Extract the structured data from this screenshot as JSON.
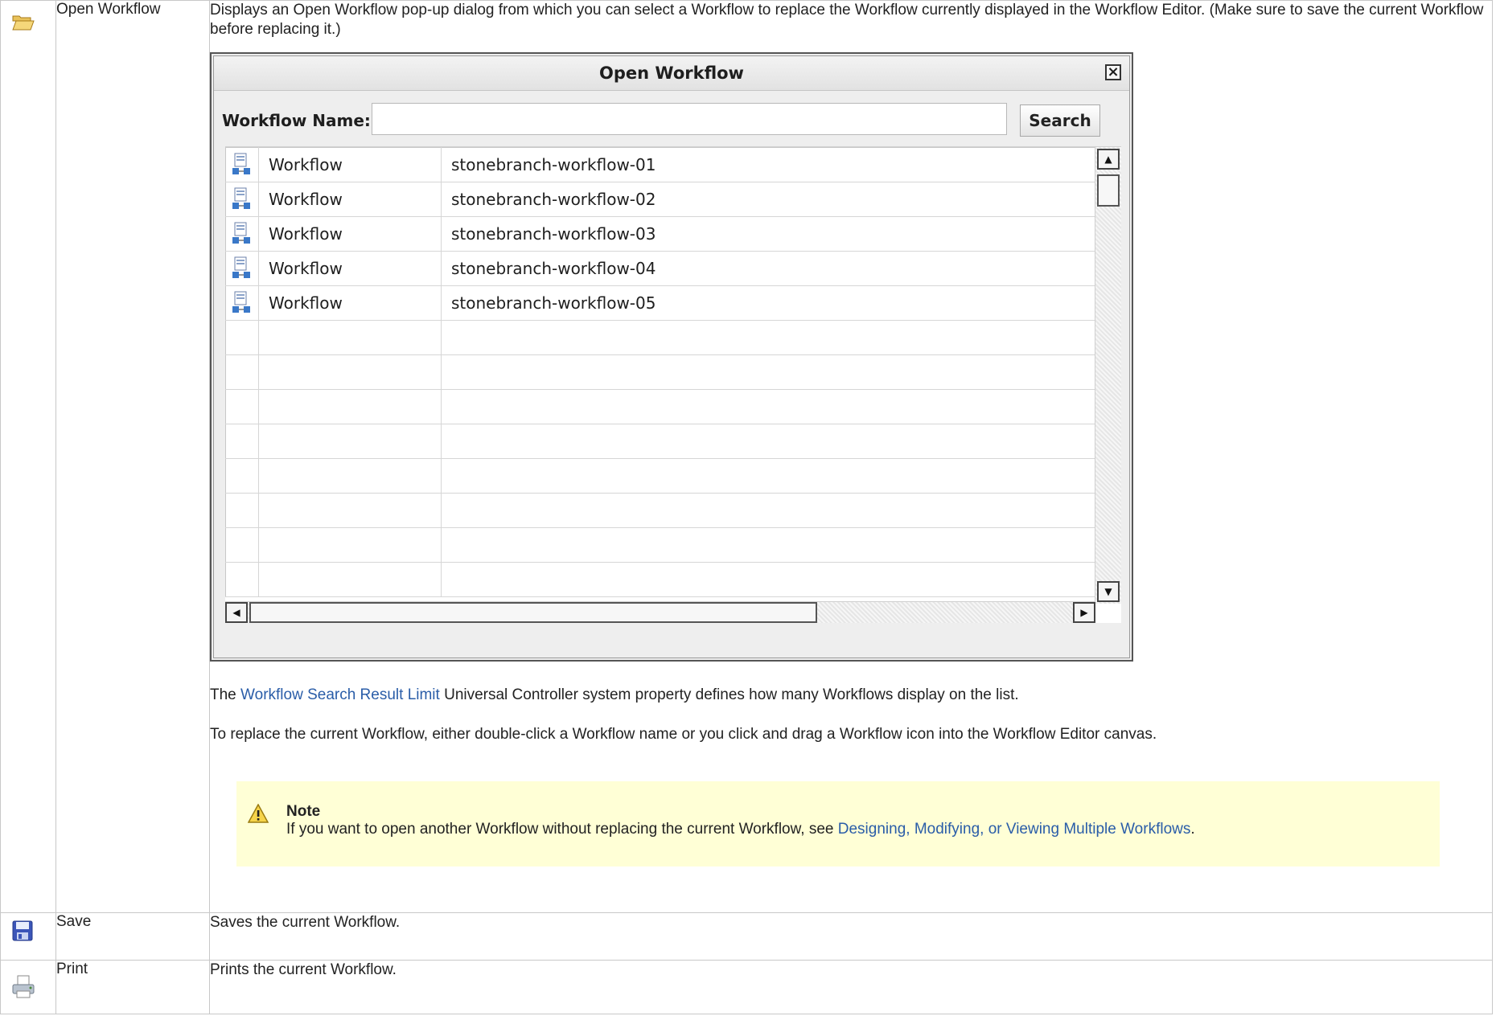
{
  "rows": {
    "open": {
      "icon": "folder-open-icon",
      "name": "Open Workflow",
      "description": "Displays an Open Workflow pop-up dialog from which you can select a Workflow to replace the Workflow currently displayed in the Workflow Editor. (Make sure to save the current Workflow before replacing it.)",
      "dialog": {
        "title": "Open Workflow",
        "close_icon": "close-icon",
        "search_label": "Workflow Name:",
        "search_value": "",
        "search_button": "Search",
        "items": [
          {
            "type": "Workflow",
            "name": "stonebranch-workflow-01",
            "icon": "workflow-icon"
          },
          {
            "type": "Workflow",
            "name": "stonebranch-workflow-02",
            "icon": "workflow-icon"
          },
          {
            "type": "Workflow",
            "name": "stonebranch-workflow-03",
            "icon": "workflow-icon"
          },
          {
            "type": "Workflow",
            "name": "stonebranch-workflow-04",
            "icon": "workflow-icon"
          },
          {
            "type": "Workflow",
            "name": "stonebranch-workflow-05",
            "icon": "workflow-icon"
          }
        ]
      },
      "para1_before": "The ",
      "para1_link": "Workflow Search Result Limit",
      "para1_after": " Universal Controller system property defines how many Workflows display on the list.",
      "para2": "To replace the current Workflow, either double-click a Workflow name or you click and drag a Workflow icon into the Workflow Editor canvas.",
      "note": {
        "icon": "warning-icon",
        "title": "Note",
        "text_before": "If you want to open another Workflow without replacing the current Workflow, see ",
        "link": "Designing, Modifying, or Viewing Multiple Workflows",
        "text_after": "."
      }
    },
    "save": {
      "icon": "save-icon",
      "name": "Save",
      "description": "Saves the current Workflow."
    },
    "print": {
      "icon": "print-icon",
      "name": "Print",
      "description": "Prints the current Workflow."
    }
  },
  "colors": {
    "link": "#2a5da8",
    "note_bg": "#ffffd6"
  }
}
